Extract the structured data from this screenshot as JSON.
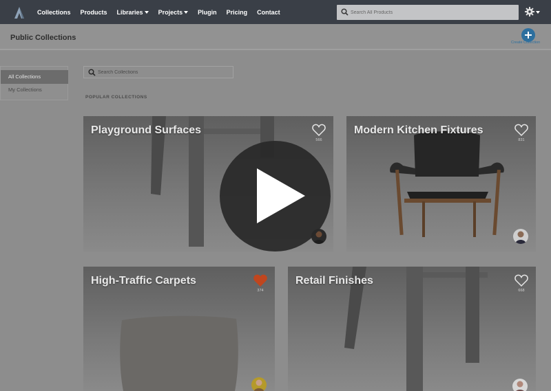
{
  "nav": {
    "links": [
      {
        "label": "Collections",
        "dropdown": false
      },
      {
        "label": "Products",
        "dropdown": false
      },
      {
        "label": "Libraries",
        "dropdown": true
      },
      {
        "label": "Projects",
        "dropdown": true
      },
      {
        "label": "Plugin",
        "dropdown": false
      },
      {
        "label": "Pricing",
        "dropdown": false
      },
      {
        "label": "Contact",
        "dropdown": false
      }
    ],
    "search_placeholder": "Search All Products",
    "settings_icon": "gear-icon"
  },
  "header": {
    "title": "Public Collections",
    "create_label": "Create Collection"
  },
  "sidebar": {
    "items": [
      {
        "label": "All Collections",
        "active": true
      },
      {
        "label": "My Collections",
        "active": false
      }
    ]
  },
  "main": {
    "search_placeholder": "Search Collections",
    "section_label": "POPULAR COLLECTIONS",
    "cards": [
      {
        "title": "Playground Surfaces",
        "likes": "566",
        "liked": false
      },
      {
        "title": "Modern Kitchen Fixtures",
        "likes": "831",
        "liked": false
      },
      {
        "title": "High-Traffic Carpets",
        "likes": "374",
        "liked": true
      },
      {
        "title": "Retail Finishes",
        "likes": "668",
        "liked": false
      }
    ]
  },
  "colors": {
    "nav_bg": "#3a3f47",
    "accent": "#2d6f9e",
    "liked_heart": "#c0461e"
  },
  "overlay": {
    "icon": "play-icon"
  }
}
